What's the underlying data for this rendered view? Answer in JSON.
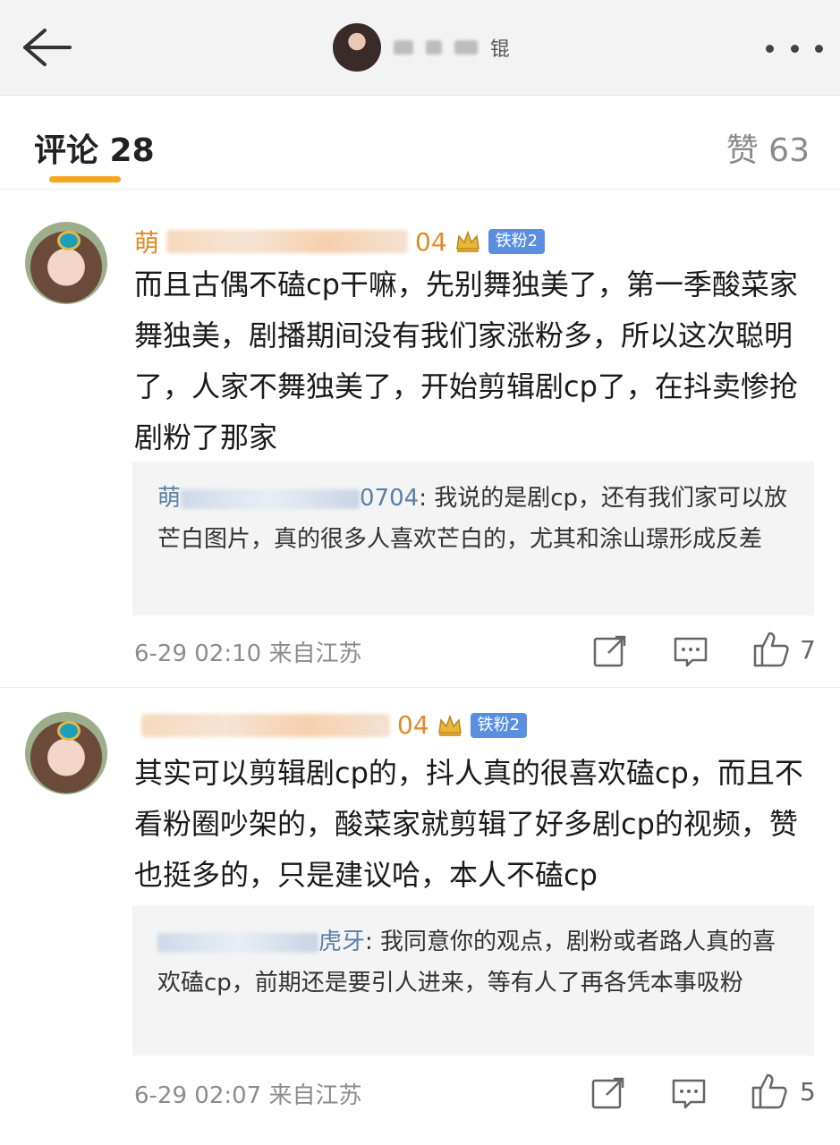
{
  "header": {
    "back_label": "",
    "user_name_partial": "锟"
  },
  "tabs": {
    "comments_label": "评论 28",
    "likes_label": "赞 63"
  },
  "comments": [
    {
      "username_visible": "萌",
      "username_suffix": "04",
      "badge": "铁粉2",
      "text": "而且古偶不磕cp干嘛，先别舞独美了，第一季酸菜家舞独美，剧播期间没有我们家涨粉多，所以这次聪明了，人家不舞独美了，开始剪辑剧cp了，在抖卖惨抢剧粉了那家",
      "reply": {
        "user_prefix": "萌",
        "user_suffix": "0704",
        "text": ": 我说的是剧cp，还有我们家可以放芒白图片，真的很多人喜欢芒白的，尤其和涂山璟形成反差"
      },
      "meta": "6-29 02:10  来自江苏",
      "likes": "7"
    },
    {
      "username_visible": "",
      "username_suffix": "04",
      "badge": "铁粉2",
      "text": "其实可以剪辑剧cp的，抖人真的很喜欢磕cp，而且不看粉圈吵架的，酸菜家就剪辑了好多剧cp的视频，赞也挺多的，只是建议哈，本人不磕cp",
      "reply": {
        "user_prefix": "",
        "user_suffix": "虎牙",
        "text": ": 我同意你的观点，剧粉或者路人真的喜欢磕cp，前期还是要引人进来，等有人了再各凭本事吸粉"
      },
      "meta": "6-29 02:07  来自江苏",
      "likes": "5"
    }
  ],
  "icons": {
    "back": "arrow-left-icon",
    "more": "more-dots-icon",
    "share": "share-icon",
    "comment": "comment-icon",
    "like": "thumbs-up-icon"
  },
  "colors": {
    "accent_underline": "#f5a623",
    "username": "#e08a2c",
    "badge": "#5a8fe0",
    "reply_user": "#5a7fa8"
  }
}
